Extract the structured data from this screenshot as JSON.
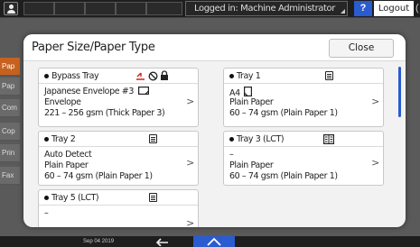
{
  "topbar": {
    "login_status": "Logged in: Machine Administrator",
    "help_label": "?",
    "logout_label": "Logout",
    "last_glyph": "("
  },
  "background_tabs": [
    "Pap",
    "Pap",
    "Com",
    "Cop",
    "Prin",
    "Fax"
  ],
  "modal": {
    "title": "Paper Size/Paper Type",
    "close_label": "Close",
    "trays": [
      {
        "name": "Bypass Tray",
        "size": "Japanese Envelope #3",
        "type": "Envelope",
        "weight": "221 – 256 gsm (Thick Paper 3)",
        "icons": [
          "bypass-tray-icon",
          "prohibited-icon",
          "lock-icon",
          "landscape-orientation-icon"
        ]
      },
      {
        "name": "Tray 1",
        "size": "A4",
        "type": "Plain Paper",
        "weight": "60 – 74 gsm (Plain Paper 1)",
        "icons": [
          "paper-tray-icon",
          "portrait-orientation-icon"
        ]
      },
      {
        "name": "Tray 2",
        "size": "Auto Detect",
        "type": "Plain Paper",
        "weight": "60 – 74 gsm (Plain Paper 1)",
        "icons": [
          "paper-tray-icon"
        ]
      },
      {
        "name": "Tray 3 (LCT)",
        "size": "–",
        "type": "Plain Paper",
        "weight": "60 – 74 gsm (Plain Paper 1)",
        "icons": [
          "lct-tray-icon"
        ]
      },
      {
        "name": "Tray 5 (LCT)",
        "size": "–",
        "type": "",
        "weight": "",
        "icons": [
          "paper-tray-icon"
        ]
      }
    ]
  },
  "bottombar": {
    "date": "Sep 04 2019"
  },
  "colors": {
    "accent_blue": "#2a5bd0",
    "active_tab_orange": "#c7611f",
    "bypass_icon_red": "#d0201a"
  }
}
